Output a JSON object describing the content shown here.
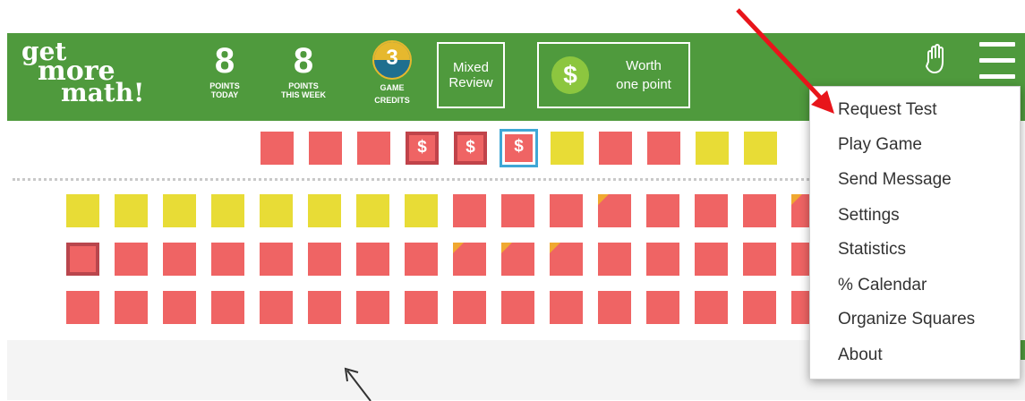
{
  "logo": {
    "line1": "get",
    "line2": "more",
    "line3": "math!"
  },
  "stats": [
    {
      "value": "8",
      "label_line1": "POINTS",
      "label_line2": "TODAY"
    },
    {
      "value": "8",
      "label_line1": "POINTS",
      "label_line2": "THIS WEEK"
    }
  ],
  "credits": {
    "value": "3",
    "label_line1": "GAME",
    "label_line2": "CREDITS"
  },
  "mixed_review": {
    "label": "Mixed Review"
  },
  "worth": {
    "coin_symbol": "$",
    "line1": "Worth",
    "line2": "one point"
  },
  "icons": {
    "hand": "hand-icon",
    "menu": "hamburger-menu-icon"
  },
  "top_row": [
    {
      "color": "red"
    },
    {
      "color": "red"
    },
    {
      "color": "red"
    },
    {
      "color": "red",
      "label": "$"
    },
    {
      "color": "red",
      "label": "$"
    },
    {
      "color": "red",
      "label": "$",
      "selected": true
    },
    {
      "color": "yellow"
    },
    {
      "color": "red"
    },
    {
      "color": "red"
    },
    {
      "color": "yellow"
    },
    {
      "color": "yellow"
    }
  ],
  "grid_rows": [
    [
      "yellow",
      "yellow",
      "yellow",
      "yellow",
      "yellow",
      "yellow",
      "yellow",
      "yellow",
      "red",
      "red",
      "red",
      "red-corner",
      "red",
      "red",
      "red",
      "red-corner"
    ],
    [
      "red-current",
      "red",
      "red",
      "red",
      "red",
      "red",
      "red",
      "red",
      "red-corner",
      "red-corner",
      "red-corner",
      "red",
      "red",
      "red",
      "red",
      "red"
    ],
    [
      "red",
      "red",
      "red",
      "red",
      "red",
      "red",
      "red",
      "red",
      "red",
      "red",
      "red",
      "red",
      "red",
      "red",
      "red",
      "red"
    ]
  ],
  "menu": {
    "items": [
      "Request Test",
      "Play Game",
      "Send Message",
      "Settings",
      "Statistics",
      "% Calendar",
      "Organize Squares",
      "About"
    ]
  },
  "colors": {
    "header_green": "#4f9a3d",
    "square_red": "#ef6464",
    "square_yellow": "#e8dc36",
    "annotation_arrow": "#e8151b"
  }
}
